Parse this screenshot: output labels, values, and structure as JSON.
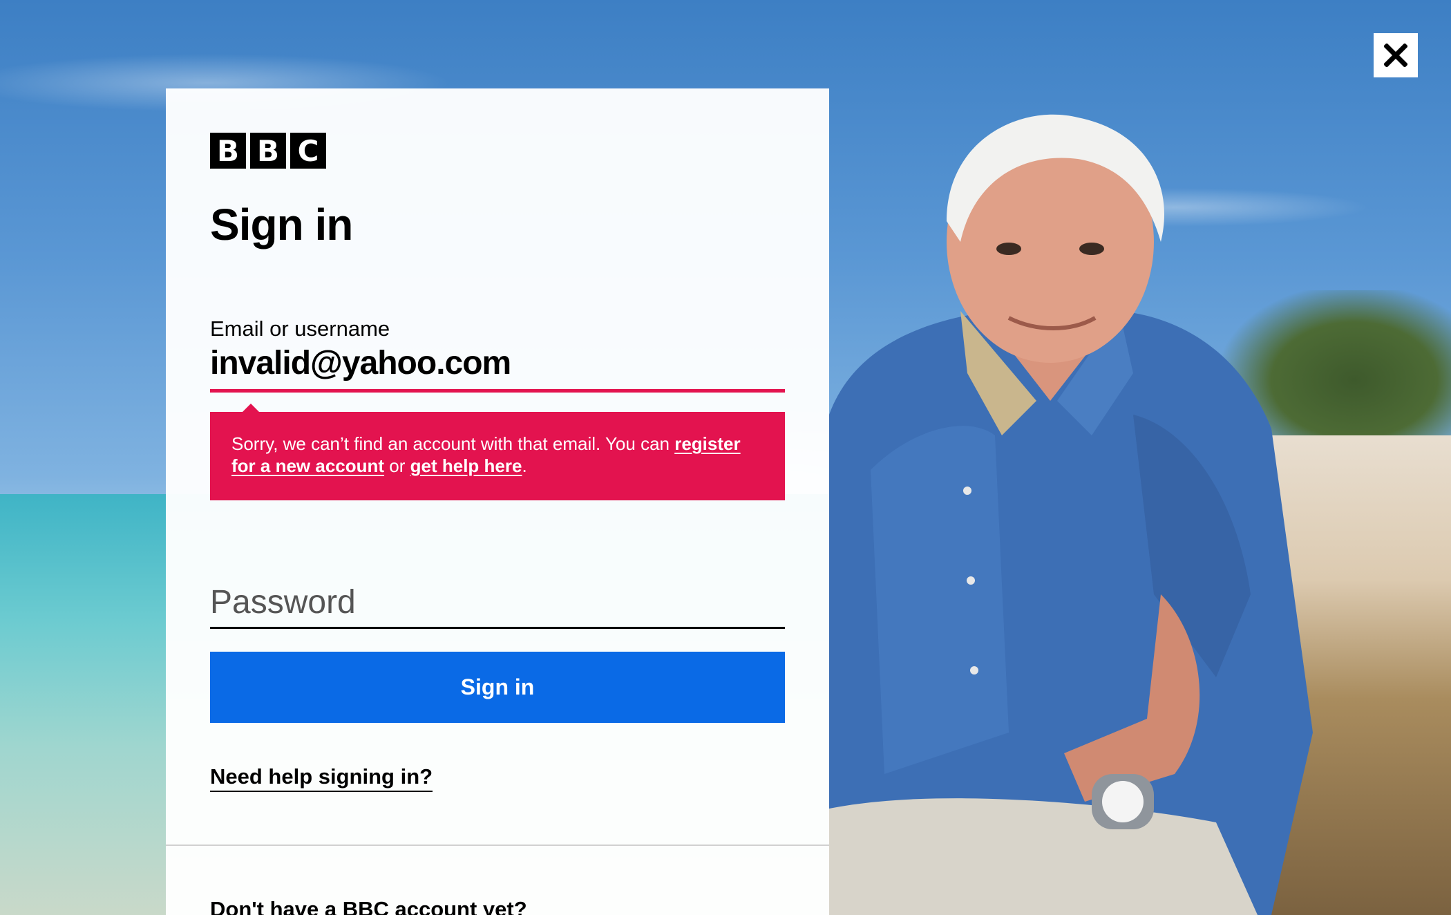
{
  "brand": {
    "logo_letters": [
      "B",
      "B",
      "C"
    ]
  },
  "panel": {
    "title": "Sign in",
    "email": {
      "label": "Email or username",
      "value": "invalid@yahoo.com"
    },
    "error": {
      "message_prefix": "Sorry, we can’t find an account with that email. You can ",
      "register_link": "register for a new account",
      "middle": " or ",
      "help_link": "get help here",
      "suffix": "."
    },
    "password": {
      "placeholder": "Password"
    },
    "signin_button": "Sign in",
    "help_link": "Need help signing in?",
    "no_account_heading": "Don't have a BBC account yet?"
  },
  "close_button": {
    "icon": "close-icon"
  },
  "colors": {
    "error": "#e3134f",
    "primary_button": "#0a6ae6"
  }
}
